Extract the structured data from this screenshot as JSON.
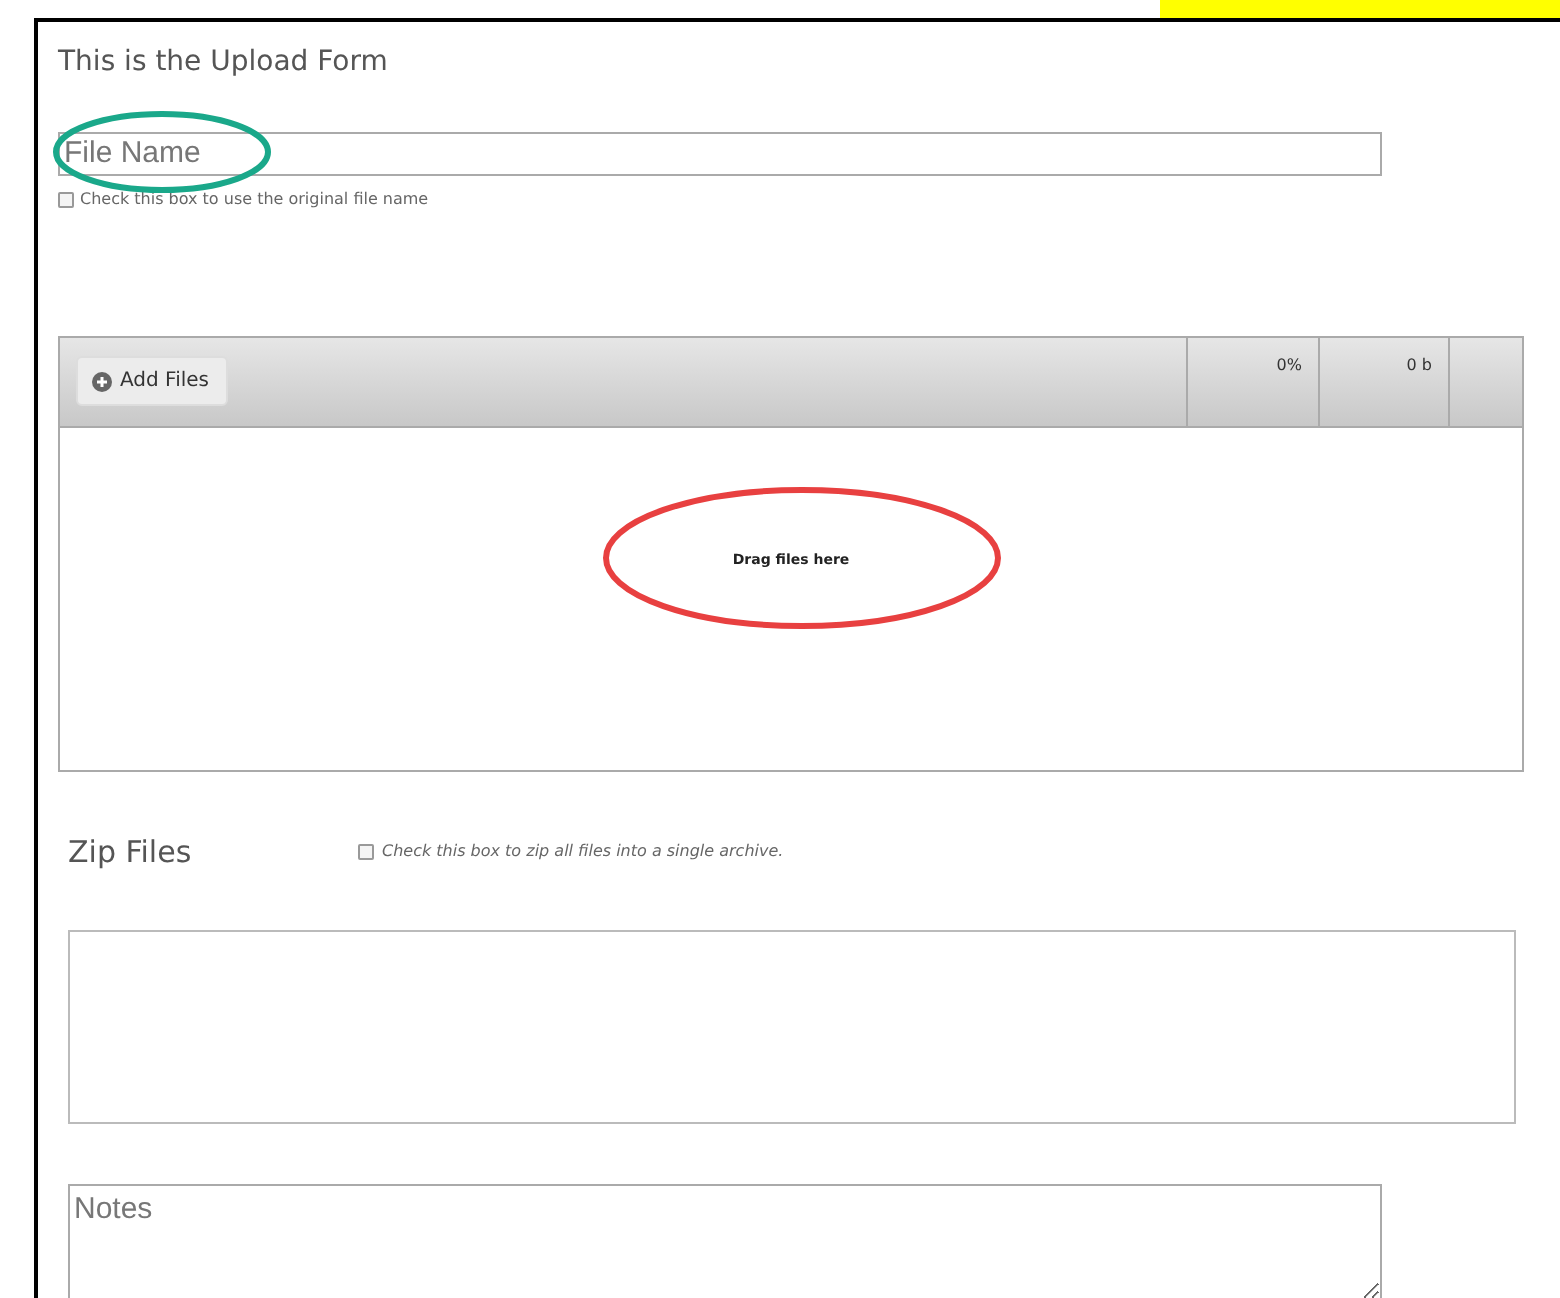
{
  "form": {
    "title": "This is the Upload Form",
    "file_name": {
      "placeholder": "File Name"
    },
    "original_name_checkbox": {
      "label": "Check this box to use the original file name",
      "checked": false
    },
    "uploader": {
      "add_button": "Add Files",
      "percent": "0%",
      "size": "0 b",
      "drop_hint": "Drag files here"
    },
    "zip": {
      "label": "Zip Files",
      "checkbox_label": "Check this box to zip all files into a single archive.",
      "checked": false
    },
    "notes": {
      "placeholder": "Notes"
    }
  }
}
